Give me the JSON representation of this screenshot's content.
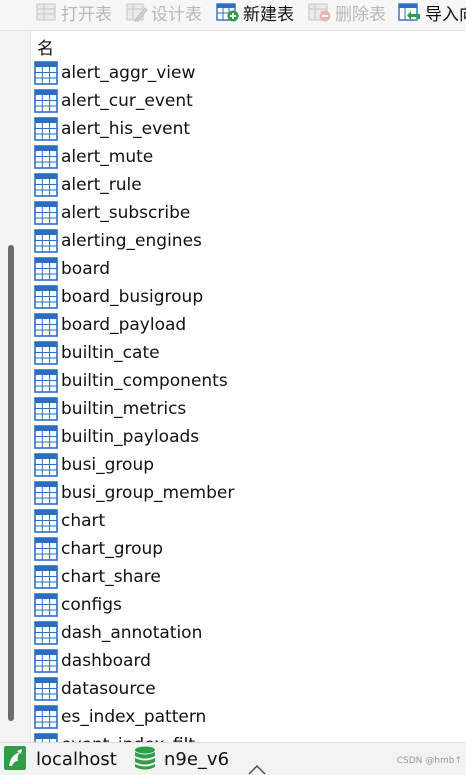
{
  "toolbar": {
    "open_table": "打开表",
    "design_table": "设计表",
    "new_table": "新建表",
    "delete_table": "删除表",
    "import": "导入向"
  },
  "list": {
    "column_header": "名",
    "tables": [
      "alert_aggr_view",
      "alert_cur_event",
      "alert_his_event",
      "alert_mute",
      "alert_rule",
      "alert_subscribe",
      "alerting_engines",
      "board",
      "board_busigroup",
      "board_payload",
      "builtin_cate",
      "builtin_components",
      "builtin_metrics",
      "builtin_payloads",
      "busi_group",
      "busi_group_member",
      "chart",
      "chart_group",
      "chart_share",
      "configs",
      "dash_annotation",
      "dashboard",
      "datasource",
      "es_index_pattern",
      "event_index_filt"
    ]
  },
  "statusbar": {
    "connection": "localhost",
    "database": "n9e_v6",
    "watermark": "CSDN @hmb↑"
  },
  "colors": {
    "table_icon": "#2b6fc2",
    "connection_icon": "#2e9e47",
    "database_icon": "#2e9e47"
  }
}
